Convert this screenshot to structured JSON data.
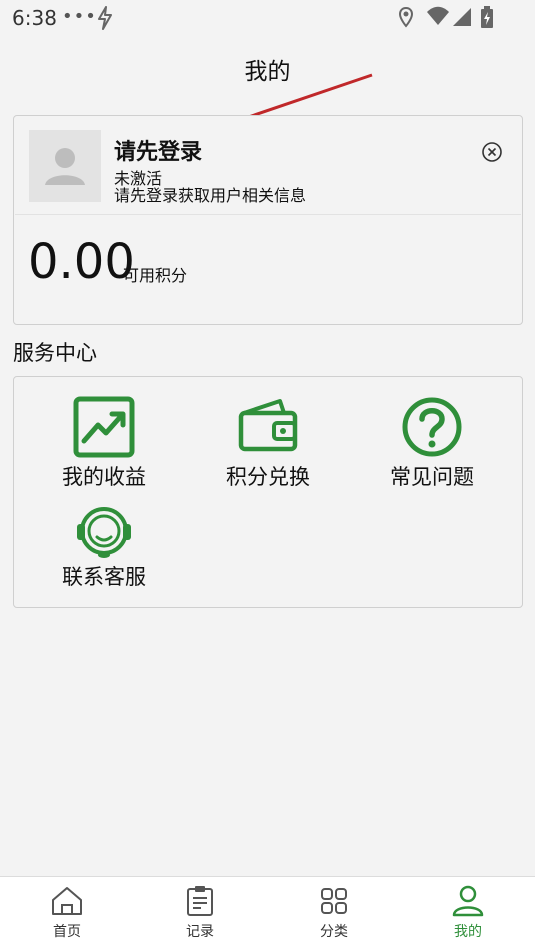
{
  "status_bar": {
    "time": "6:38",
    "dots": "•••"
  },
  "header": {
    "title": "我的"
  },
  "profile": {
    "login_title": "请先登录",
    "activation_status": "未激活",
    "hint": "请先登录获取用户相关信息",
    "points_value": "0.00",
    "points_label": "可用积分"
  },
  "services": {
    "section_title": "服务中心",
    "items": [
      {
        "label": "我的收益",
        "icon": "earnings-chart-icon"
      },
      {
        "label": "积分兑换",
        "icon": "wallet-icon"
      },
      {
        "label": "常见问题",
        "icon": "question-icon"
      },
      {
        "label": "联系客服",
        "icon": "customer-service-icon"
      }
    ]
  },
  "tabbar": {
    "tabs": [
      {
        "label": "首页",
        "icon": "home-icon"
      },
      {
        "label": "记录",
        "icon": "clipboard-icon"
      },
      {
        "label": "分类",
        "icon": "grid-icon"
      },
      {
        "label": "我的",
        "icon": "user-icon",
        "active": true
      }
    ]
  },
  "colors": {
    "accent": "#2f8f3a",
    "annotation_arrow": "#c0282a"
  }
}
